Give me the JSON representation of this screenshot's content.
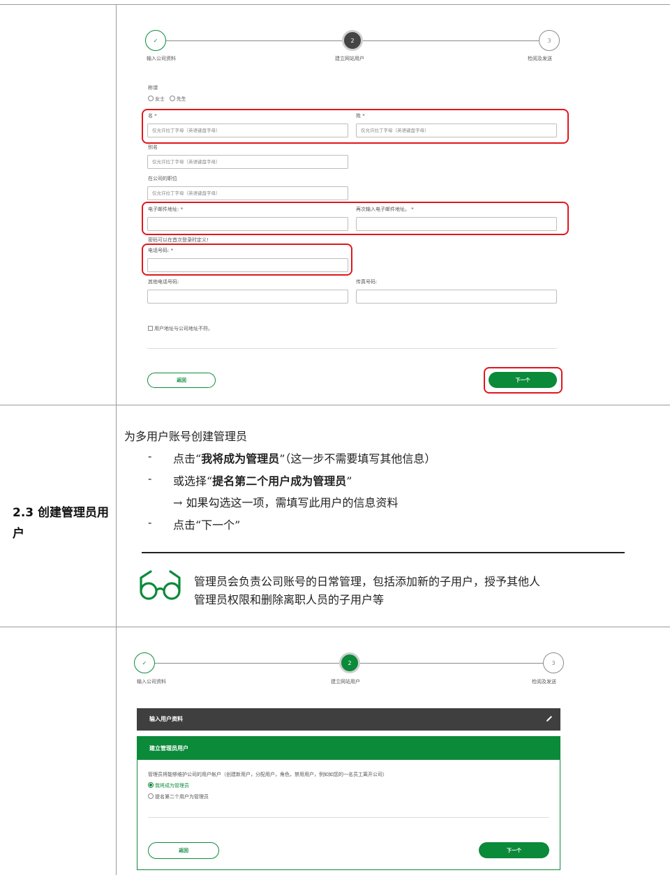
{
  "top_form": {
    "steps": [
      {
        "label": "输入公司资料",
        "symbol": "✓"
      },
      {
        "label": "建立网站用户",
        "symbol": "2"
      },
      {
        "label": "检阅及发送",
        "symbol": "3"
      }
    ],
    "salutation_label": "称谓",
    "salutation_options": [
      "女士",
      "先生"
    ],
    "first_name_label": "名 *",
    "first_name_placeholder": "仅允许拉丁字母（英语键盘字母）",
    "last_name_label": "姓 *",
    "last_name_placeholder": "仅允许拉丁字母（英语键盘字母）",
    "alias_label": "别名",
    "alias_placeholder": "仅允许拉丁字母（英语键盘字母）",
    "position_label": "在公司的职位",
    "position_placeholder": "仅允许拉丁字母（英语键盘字母）",
    "email_label": "电子邮件地址: *",
    "email_confirm_label": "再次输入电子邮件地址。 *",
    "password_note": "密码可以在首次登录时定义!",
    "phone_label": "电话号码: *",
    "other_phone_label": "其他电话号码:",
    "fax_label": "传真号码:",
    "address_checkbox_label": "用户地址与公司地址不符。",
    "back_label": "返回",
    "next_label": "下一个"
  },
  "section": {
    "title": "2.3 创建管理员用户",
    "intro": "为多用户账号创建管理员",
    "bullet1_prefix": "点击“",
    "bullet1_bold": "我将成为管理员",
    "bullet1_suffix": "”（这一步不需要填写其他信息）",
    "bullet2_prefix": "或选择“",
    "bullet2_bold": "提名第二个用户成为管理员",
    "bullet2_suffix": "”",
    "sub_note": "→ 如果勾选这一项，需填写此用户的信息资料",
    "bullet3": "点击“下一个”",
    "dash": "-",
    "tip_line1": "管理员会负责公司账号的日常管理，包括添加新的子用户，授予其他人",
    "tip_line2": "管理员权限和删除离职人员的子用户等",
    "tip_icon": "glasses-icon"
  },
  "bottom_form": {
    "steps": [
      {
        "label": "输入公司资料",
        "symbol": "✓"
      },
      {
        "label": "建立网站用户",
        "symbol": "2"
      },
      {
        "label": "检阅及发送",
        "symbol": "3"
      }
    ],
    "collapsed_panel_title": "输入用户资料",
    "active_panel_title": "建立管理员用户",
    "description": "管理员将能够维护公司的用户帐户（创建新用户，分配用户，角色，禁用用户，例如如您的一名员工离开公司）",
    "option1": "我将成为管理员",
    "option2": "提名第二个用户为管理员",
    "back_label": "返回",
    "next_label": "下一个"
  },
  "colors": {
    "brand_green": "#0b8a3a",
    "highlight_red": "#e0161c"
  }
}
